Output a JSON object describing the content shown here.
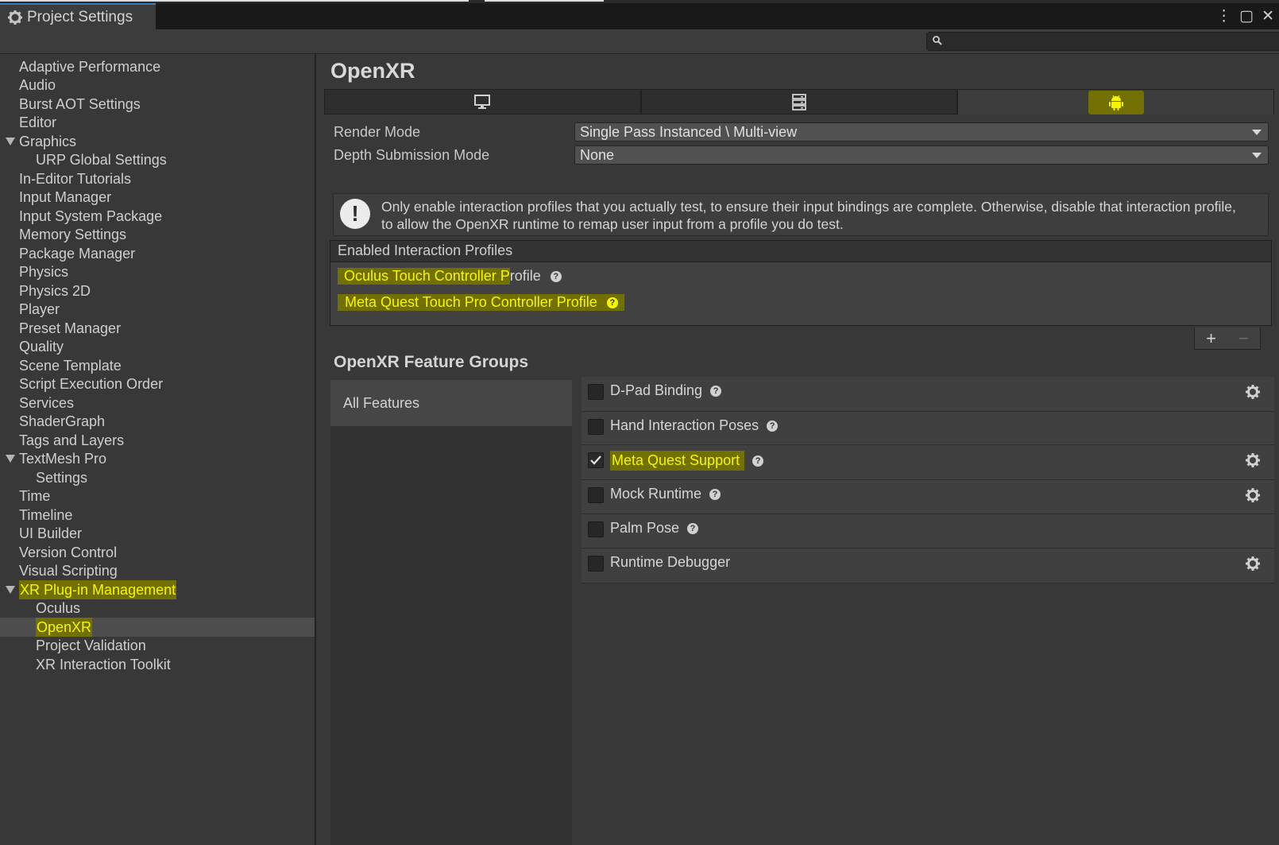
{
  "window": {
    "tab_title": "Project Settings",
    "search_placeholder": ""
  },
  "sidebar": {
    "items": [
      {
        "label": "Adaptive Performance"
      },
      {
        "label": "Audio"
      },
      {
        "label": "Burst AOT Settings"
      },
      {
        "label": "Editor"
      },
      {
        "label": "Graphics",
        "expanded": true
      },
      {
        "label": "URP Global Settings",
        "child": true
      },
      {
        "label": "In-Editor Tutorials"
      },
      {
        "label": "Input Manager"
      },
      {
        "label": "Input System Package"
      },
      {
        "label": "Memory Settings"
      },
      {
        "label": "Package Manager"
      },
      {
        "label": "Physics"
      },
      {
        "label": "Physics 2D"
      },
      {
        "label": "Player"
      },
      {
        "label": "Preset Manager"
      },
      {
        "label": "Quality"
      },
      {
        "label": "Scene Template"
      },
      {
        "label": "Script Execution Order"
      },
      {
        "label": "Services"
      },
      {
        "label": "ShaderGraph"
      },
      {
        "label": "Tags and Layers"
      },
      {
        "label": "TextMesh Pro",
        "expanded": true
      },
      {
        "label": "Settings",
        "child": true
      },
      {
        "label": "Time"
      },
      {
        "label": "Timeline"
      },
      {
        "label": "UI Builder"
      },
      {
        "label": "Version Control"
      },
      {
        "label": "Visual Scripting"
      },
      {
        "label": "XR Plug-in Management",
        "expanded": true,
        "highlighted": true
      },
      {
        "label": "Oculus",
        "child": true
      },
      {
        "label": "OpenXR",
        "child": true,
        "selected": true,
        "highlighted": true
      },
      {
        "label": "Project Validation",
        "child": true
      },
      {
        "label": "XR Interaction Toolkit",
        "child": true
      }
    ]
  },
  "main": {
    "title": "OpenXR",
    "platform_tabs": [
      {
        "icon": "monitor-icon"
      },
      {
        "icon": "server-icon"
      },
      {
        "icon": "android-icon",
        "active": true
      }
    ],
    "render_mode": {
      "label": "Render Mode",
      "value": "Single Pass Instanced \\ Multi-view"
    },
    "depth_submission": {
      "label": "Depth Submission Mode",
      "value": "None"
    },
    "help_text": "Only enable interaction profiles that you actually test, to ensure their input bindings are complete. Otherwise, disable that interaction profile, to allow the OpenXR runtime to remap user input from a profile you do test.",
    "profiles": {
      "header": "Enabled Interaction Profiles",
      "items": [
        {
          "highlighted_part": "Oculus Touch Controller P",
          "rest": "rofile"
        },
        {
          "highlighted_part": "Meta Quest Touch Pro Controller Profile",
          "rest": ""
        }
      ]
    },
    "feature_groups": {
      "title": "OpenXR Feature Groups",
      "groups": [
        "All Features"
      ],
      "features": [
        {
          "label": "D-Pad Binding",
          "checked": false,
          "has_settings": true
        },
        {
          "label": "Hand Interaction Poses",
          "checked": false,
          "has_settings": false
        },
        {
          "label": "Meta Quest Support",
          "checked": true,
          "has_settings": true,
          "highlighted": true
        },
        {
          "label": "Mock Runtime",
          "checked": false,
          "has_settings": true
        },
        {
          "label": "Palm Pose",
          "checked": false,
          "has_settings": false
        },
        {
          "label": "Runtime Debugger",
          "checked": false,
          "has_settings": true
        }
      ]
    },
    "list_buttons": {
      "plus": "+",
      "minus": "−"
    }
  },
  "colors": {
    "highlight_bg": "#727000",
    "highlight_text": "#f6f600",
    "panel_bg": "#383838",
    "selected_row": "#4d4d4d"
  }
}
